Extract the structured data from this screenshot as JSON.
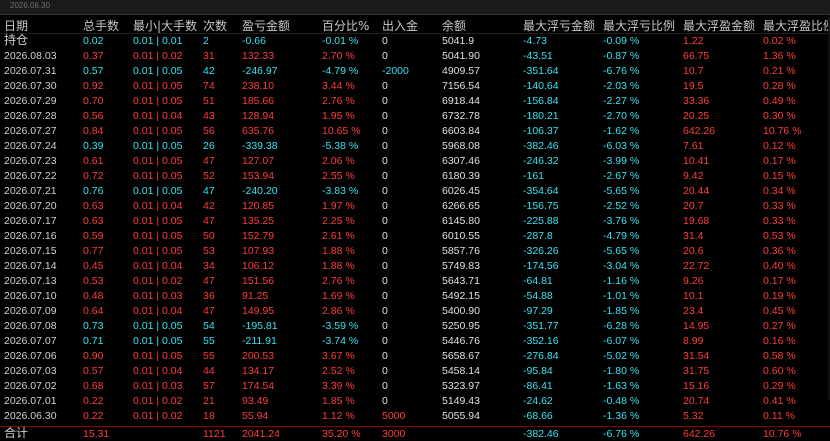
{
  "top_date": "2026.06.30",
  "headers": [
    "日期",
    "总手数",
    "最小|大手数",
    "次数",
    "盈亏金额",
    "百分比%",
    "出入金",
    "余额",
    "最大浮亏金额",
    "最大浮亏比例",
    "最大浮盈金额",
    "最大浮盈比例"
  ],
  "held_row": {
    "label": "持仓",
    "total": "0.02",
    "minmax": "0.01 | 0.01",
    "count": "2",
    "pnl": "-0.66",
    "pct": "-0.01 %",
    "inout": "0",
    "balance": "5041.9",
    "max_loss": "-4.73",
    "max_loss_pct": "-0.09 %",
    "max_gain": "1.22",
    "max_gain_pct": "0.02 %"
  },
  "rows": [
    {
      "date": "2026.08.03",
      "total": "0.37",
      "minmax": "0.01 | 0.02",
      "count": "31",
      "pnl": "132.33",
      "pct": "2.70 %",
      "inout": "0",
      "balance": "5041.90",
      "max_loss": "-43.51",
      "max_loss_pct": "-0.87 %",
      "max_gain": "66.75",
      "max_gain_pct": "1.36 %"
    },
    {
      "date": "2026.07.31",
      "total": "0.57",
      "minmax": "0.01 | 0.05",
      "count": "42",
      "pnl": "-246.97",
      "pct": "-4.79 %",
      "inout": "-2000",
      "balance": "4909.57",
      "max_loss": "-351.64",
      "max_loss_pct": "-6.76 %",
      "max_gain": "10.7",
      "max_gain_pct": "0.21 %"
    },
    {
      "date": "2026.07.30",
      "total": "0.92",
      "minmax": "0.01 | 0.05",
      "count": "74",
      "pnl": "238.10",
      "pct": "3.44 %",
      "inout": "0",
      "balance": "7156.54",
      "max_loss": "-140.64",
      "max_loss_pct": "-2.03 %",
      "max_gain": "19.5",
      "max_gain_pct": "0.28 %"
    },
    {
      "date": "2026.07.29",
      "total": "0.70",
      "minmax": "0.01 | 0.05",
      "count": "51",
      "pnl": "185.66",
      "pct": "2.76 %",
      "inout": "0",
      "balance": "6918.44",
      "max_loss": "-156.84",
      "max_loss_pct": "-2.27 %",
      "max_gain": "33.36",
      "max_gain_pct": "0.49 %"
    },
    {
      "date": "2026.07.28",
      "total": "0.56",
      "minmax": "0.01 | 0.04",
      "count": "43",
      "pnl": "128.94",
      "pct": "1.95 %",
      "inout": "0",
      "balance": "6732.78",
      "max_loss": "-180.21",
      "max_loss_pct": "-2.70 %",
      "max_gain": "20.25",
      "max_gain_pct": "0.30 %"
    },
    {
      "date": "2026.07.27",
      "total": "0.84",
      "minmax": "0.01 | 0.05",
      "count": "56",
      "pnl": "635.76",
      "pct": "10.65 %",
      "inout": "0",
      "balance": "6603.84",
      "max_loss": "-106.37",
      "max_loss_pct": "-1.62 %",
      "max_gain": "642.26",
      "max_gain_pct": "10.76 %"
    },
    {
      "date": "2026.07.24",
      "total": "0.39",
      "minmax": "0.01 | 0.05",
      "count": "26",
      "pnl": "-339.38",
      "pct": "-5.38 %",
      "inout": "0",
      "balance": "5968.08",
      "max_loss": "-382.46",
      "max_loss_pct": "-6.03 %",
      "max_gain": "7.61",
      "max_gain_pct": "0.12 %"
    },
    {
      "date": "2026.07.23",
      "total": "0.61",
      "minmax": "0.01 | 0.05",
      "count": "47",
      "pnl": "127.07",
      "pct": "2.06 %",
      "inout": "0",
      "balance": "6307.46",
      "max_loss": "-246.32",
      "max_loss_pct": "-3.99 %",
      "max_gain": "10.41",
      "max_gain_pct": "0.17 %"
    },
    {
      "date": "2026.07.22",
      "total": "0.72",
      "minmax": "0.01 | 0.05",
      "count": "52",
      "pnl": "153.94",
      "pct": "2.55 %",
      "inout": "0",
      "balance": "6180.39",
      "max_loss": "-161",
      "max_loss_pct": "-2.67 %",
      "max_gain": "9.42",
      "max_gain_pct": "0.15 %"
    },
    {
      "date": "2026.07.21",
      "total": "0.76",
      "minmax": "0.01 | 0.05",
      "count": "47",
      "pnl": "-240.20",
      "pct": "-3.83 %",
      "inout": "0",
      "balance": "6026.45",
      "max_loss": "-354.64",
      "max_loss_pct": "-5.65 %",
      "max_gain": "20.44",
      "max_gain_pct": "0.34 %"
    },
    {
      "date": "2026.07.20",
      "total": "0.63",
      "minmax": "0.01 | 0.04",
      "count": "42",
      "pnl": "120.85",
      "pct": "1.97 %",
      "inout": "0",
      "balance": "6266.65",
      "max_loss": "-156.75",
      "max_loss_pct": "-2.52 %",
      "max_gain": "20.7",
      "max_gain_pct": "0.33 %"
    },
    {
      "date": "2026.07.17",
      "total": "0.63",
      "minmax": "0.01 | 0.05",
      "count": "47",
      "pnl": "135.25",
      "pct": "2.25 %",
      "inout": "0",
      "balance": "6145.80",
      "max_loss": "-225.88",
      "max_loss_pct": "-3.76 %",
      "max_gain": "19.68",
      "max_gain_pct": "0.33 %"
    },
    {
      "date": "2026.07.16",
      "total": "0.59",
      "minmax": "0.01 | 0.05",
      "count": "50",
      "pnl": "152.79",
      "pct": "2.61 %",
      "inout": "0",
      "balance": "6010.55",
      "max_loss": "-287.8",
      "max_loss_pct": "-4.79 %",
      "max_gain": "31.4",
      "max_gain_pct": "0.53 %"
    },
    {
      "date": "2026.07.15",
      "total": "0.77",
      "minmax": "0.01 | 0.05",
      "count": "53",
      "pnl": "107.93",
      "pct": "1.88 %",
      "inout": "0",
      "balance": "5857.76",
      "max_loss": "-326.26",
      "max_loss_pct": "-5.65 %",
      "max_gain": "20.6",
      "max_gain_pct": "0.36 %"
    },
    {
      "date": "2026.07.14",
      "total": "0.45",
      "minmax": "0.01 | 0.04",
      "count": "34",
      "pnl": "106.12",
      "pct": "1.88 %",
      "inout": "0",
      "balance": "5749.83",
      "max_loss": "-174.56",
      "max_loss_pct": "-3.04 %",
      "max_gain": "22.72",
      "max_gain_pct": "0.40 %"
    },
    {
      "date": "2026.07.13",
      "total": "0.53",
      "minmax": "0.01 | 0.02",
      "count": "47",
      "pnl": "151.56",
      "pct": "2.76 %",
      "inout": "0",
      "balance": "5643.71",
      "max_loss": "-64.81",
      "max_loss_pct": "-1.16 %",
      "max_gain": "9.26",
      "max_gain_pct": "0.17 %"
    },
    {
      "date": "2026.07.10",
      "total": "0.48",
      "minmax": "0.01 | 0.03",
      "count": "36",
      "pnl": "91.25",
      "pct": "1.69 %",
      "inout": "0",
      "balance": "5492.15",
      "max_loss": "-54.88",
      "max_loss_pct": "-1.01 %",
      "max_gain": "10.1",
      "max_gain_pct": "0.19 %"
    },
    {
      "date": "2026.07.09",
      "total": "0.64",
      "minmax": "0.01 | 0.04",
      "count": "47",
      "pnl": "149.95",
      "pct": "2.86 %",
      "inout": "0",
      "balance": "5400.90",
      "max_loss": "-97.29",
      "max_loss_pct": "-1.85 %",
      "max_gain": "23.4",
      "max_gain_pct": "0.45 %"
    },
    {
      "date": "2026.07.08",
      "total": "0.73",
      "minmax": "0.01 | 0.05",
      "count": "54",
      "pnl": "-195.81",
      "pct": "-3.59 %",
      "inout": "0",
      "balance": "5250.95",
      "max_loss": "-351.77",
      "max_loss_pct": "-6.28 %",
      "max_gain": "14.95",
      "max_gain_pct": "0.27 %"
    },
    {
      "date": "2026.07.07",
      "total": "0.71",
      "minmax": "0.01 | 0.05",
      "count": "55",
      "pnl": "-211.91",
      "pct": "-3.74 %",
      "inout": "0",
      "balance": "5446.76",
      "max_loss": "-352.16",
      "max_loss_pct": "-6.07 %",
      "max_gain": "8.99",
      "max_gain_pct": "0.16 %"
    },
    {
      "date": "2026.07.06",
      "total": "0.90",
      "minmax": "0.01 | 0.05",
      "count": "55",
      "pnl": "200.53",
      "pct": "3.67 %",
      "inout": "0",
      "balance": "5658.67",
      "max_loss": "-276.84",
      "max_loss_pct": "-5.02 %",
      "max_gain": "31.54",
      "max_gain_pct": "0.58 %"
    },
    {
      "date": "2026.07.03",
      "total": "0.57",
      "minmax": "0.01 | 0.04",
      "count": "44",
      "pnl": "134.17",
      "pct": "2.52 %",
      "inout": "0",
      "balance": "5458.14",
      "max_loss": "-95.84",
      "max_loss_pct": "-1.80 %",
      "max_gain": "31.75",
      "max_gain_pct": "0.60 %"
    },
    {
      "date": "2026.07.02",
      "total": "0.68",
      "minmax": "0.01 | 0.03",
      "count": "57",
      "pnl": "174.54",
      "pct": "3.39 %",
      "inout": "0",
      "balance": "5323.97",
      "max_loss": "-86.41",
      "max_loss_pct": "-1.63 %",
      "max_gain": "15.16",
      "max_gain_pct": "0.29 %"
    },
    {
      "date": "2026.07.01",
      "total": "0.22",
      "minmax": "0.01 | 0.02",
      "count": "21",
      "pnl": "93.49",
      "pct": "1.85 %",
      "inout": "0",
      "balance": "5149.43",
      "max_loss": "-24.62",
      "max_loss_pct": "-0.48 %",
      "max_gain": "20.74",
      "max_gain_pct": "0.41 %"
    },
    {
      "date": "2026.06.30",
      "total": "0.22",
      "minmax": "0.01 | 0.02",
      "count": "18",
      "pnl": "55.94",
      "pct": "1.12 %",
      "inout": "5000",
      "balance": "5055.94",
      "max_loss": "-68.66",
      "max_loss_pct": "-1.36 %",
      "max_gain": "5.32",
      "max_gain_pct": "0.11 %"
    }
  ],
  "total_row": {
    "label": "合计",
    "total": "15.31",
    "minmax": "",
    "count": "1121",
    "pnl": "2041.24",
    "pct": "35.20 %",
    "inout": "3000",
    "balance": "",
    "max_loss": "-382.46",
    "max_loss_pct": "-6.76 %",
    "max_gain": "642.26",
    "max_gain_pct": "10.76 %"
  },
  "colors": {
    "positive": "#ff3c3c",
    "negative": "#37e3f2",
    "neutral": "#e0e0e0",
    "background": "#000000"
  }
}
